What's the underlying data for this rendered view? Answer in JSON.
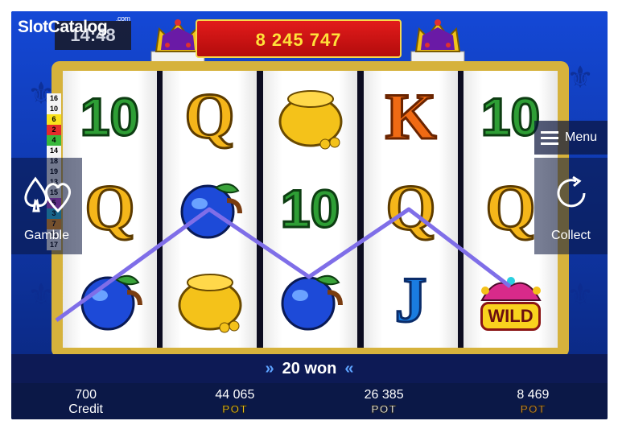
{
  "logo": {
    "text": "SlotCatalog",
    "suffix": ".com"
  },
  "clock": "14:48",
  "jackpot": "8 245 747",
  "reels": [
    [
      "10",
      "Q",
      "PLUM"
    ],
    [
      "Q",
      "PLUM",
      "POT"
    ],
    [
      "POT",
      "10",
      "PLUM"
    ],
    [
      "K",
      "Q",
      "J"
    ],
    [
      "10",
      "Q",
      "WILD"
    ]
  ],
  "wild_label": "WILD",
  "line_numbers": [
    "16",
    "10",
    "6",
    "2",
    "4",
    "14",
    "18",
    "19",
    "13",
    "15",
    "5",
    "3",
    "7",
    "11",
    "17"
  ],
  "line_colors": [
    "#f4f4f4",
    "#f4f4f4",
    "#f9e21c",
    "#e32b2b",
    "#38b83c",
    "#f4f4f4",
    "#f4f4f4",
    "#f4f4f4",
    "#f4f4f4",
    "#f4f4f4",
    "#c04ad8",
    "#2cc6e8",
    "#f79a1c",
    "#f4f4f4",
    "#f4f4f4"
  ],
  "buttons": {
    "gamble": "Gamble",
    "menu": "Menu",
    "collect": "Collect"
  },
  "won": "20 won",
  "bottom": {
    "credit_value": "700",
    "credit_label": "Credit",
    "pots": [
      {
        "value": "44 065",
        "label": "POT",
        "color": "#f2c418"
      },
      {
        "value": "26 385",
        "label": "POT",
        "color": "#ffffff"
      },
      {
        "value": "8 469",
        "label": "POT",
        "color": "#d68b2c"
      }
    ]
  },
  "colors": {
    "win_line": "#7f6ee8"
  }
}
